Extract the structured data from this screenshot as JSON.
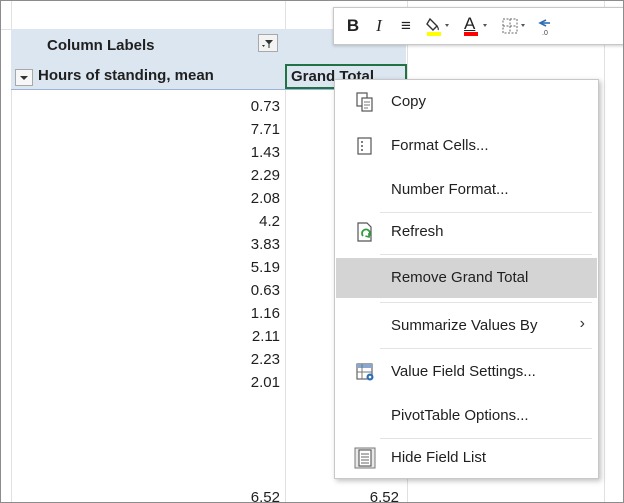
{
  "pivot": {
    "column_labels": "Column Labels",
    "row_header": "Hours of standing, mean",
    "grand_total_header": "Grand Total",
    "values": [
      "0.73",
      "7.71",
      "1.43",
      "2.29",
      "2.08",
      "4.2",
      "3.83",
      "5.19",
      "0.63",
      "1.16",
      "2.11",
      "2.23",
      "2.01",
      "6.52"
    ],
    "last_row_total": "6.52"
  },
  "mini_toolbar": {
    "bold": "B",
    "italic": "I",
    "align": "≡",
    "fill_color": "#ffff00",
    "font_color": "#ff0000",
    "font_color_letter": "A",
    "dropdown": "⌄"
  },
  "context_menu": {
    "items": [
      {
        "label": "Copy",
        "icon": "copy-icon"
      },
      {
        "label": "Format Cells...",
        "icon": "format-cells-icon"
      },
      {
        "label": "Number Format...",
        "icon": ""
      },
      {
        "label": "Refresh",
        "icon": "refresh-icon"
      },
      {
        "label": "Remove Grand Total",
        "icon": ""
      },
      {
        "label": "Summarize Values By",
        "icon": "",
        "submenu": "›"
      },
      {
        "label": "Value Field Settings...",
        "icon": "value-field-settings-icon"
      },
      {
        "label": "PivotTable Options...",
        "icon": ""
      },
      {
        "label": "Hide Field List",
        "icon": "field-list-icon"
      }
    ],
    "highlighted_index": 4
  }
}
